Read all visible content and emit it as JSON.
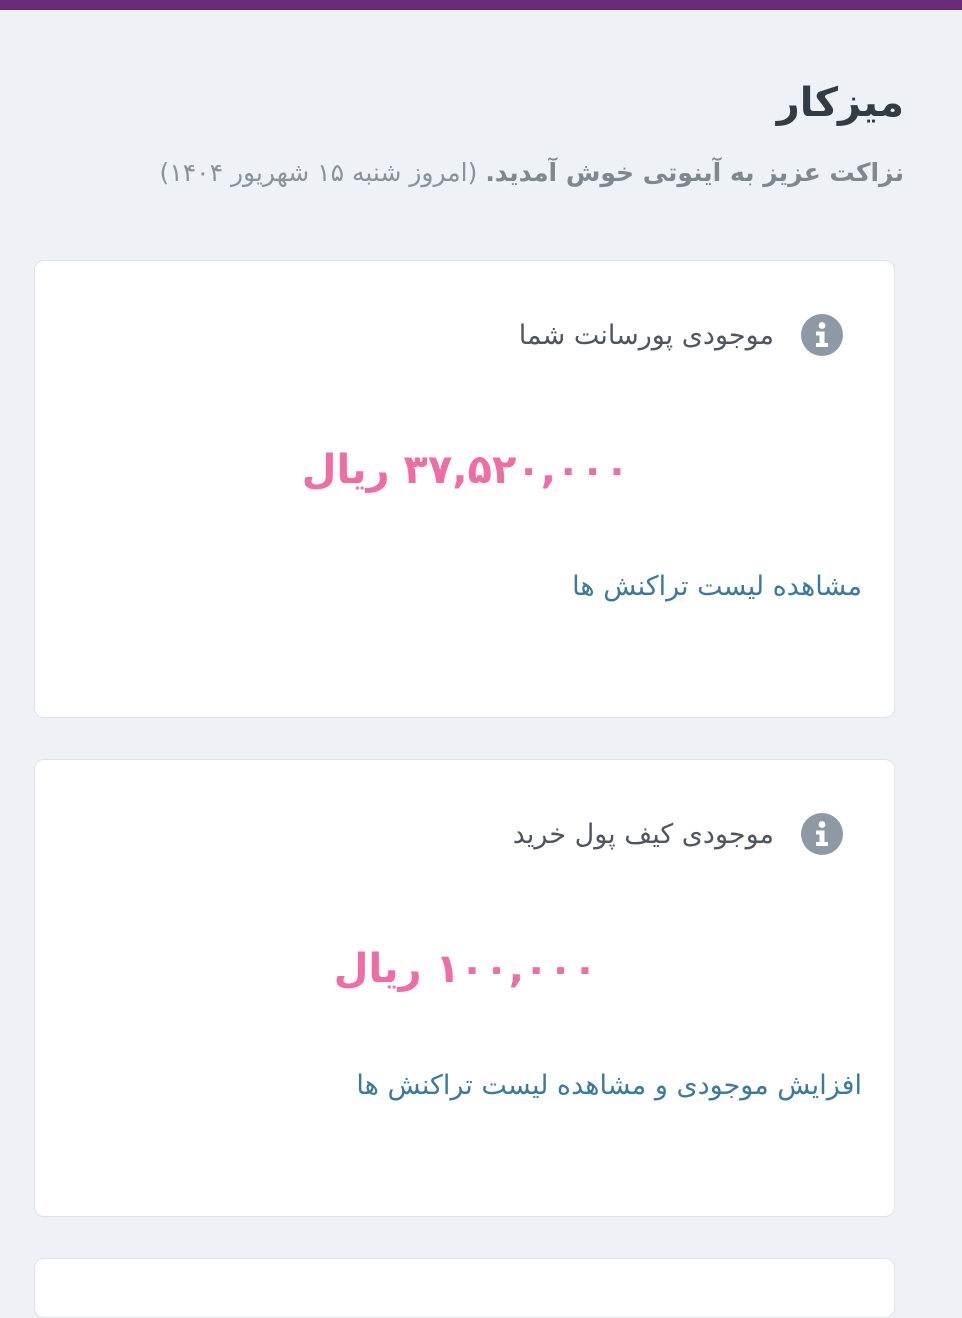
{
  "header": {
    "title": "میزکار",
    "welcome_name": "نزاکت عزیز",
    "welcome_text": " به آینوتی خوش آمدید.",
    "date_note": " (امروز شنبه ۱۵ شهریور ۱۴۰۴)"
  },
  "cards": [
    {
      "title": "موجودی پورسانت شما",
      "amount": "۳۷,۵۲۰,۰۰۰ ریال",
      "link": "مشاهده لیست تراکنش ها",
      "icon": "info-icon"
    },
    {
      "title": "موجودی کیف پول خرید",
      "amount": "۱۰۰,۰۰۰ ریال",
      "link": "افزایش موجودی و مشاهده لیست تراکنش ها",
      "icon": "info-icon"
    }
  ],
  "colors": {
    "top_bar": "#6a2a78",
    "amount": "#ec6ea5",
    "link": "#3c7a9c",
    "background": "#eef1f5"
  }
}
